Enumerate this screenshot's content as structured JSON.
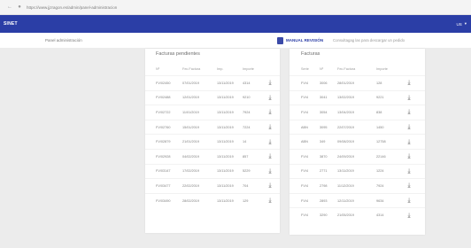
{
  "browser": {
    "url": "https://www.jjzragon.es/admin/panel-administracion"
  },
  "appbar": {
    "brand": "SINET",
    "user_label": "US"
  },
  "subbar": {
    "breadcrumb": "Panel administración",
    "manual_label": "MANUAL REVISIÓN",
    "hint": "Consultagag las para descargar un pedido"
  },
  "left_panel": {
    "title": "Facturas pendientes",
    "headers": [
      "Nº",
      "Fec.Factura",
      "Imp.",
      "Importe"
    ],
    "rows": [
      [
        "FV/02450",
        "07/01/2019",
        "13/11/2019",
        "4314"
      ],
      [
        "FV/02488",
        "12/01/2019",
        "13/11/2019",
        "9210"
      ],
      [
        "FV/02722",
        "11/01/2019",
        "13/11/2019",
        "7924"
      ],
      [
        "FV/02760",
        "15/01/2019",
        "13/11/2019",
        "7224"
      ],
      [
        "FV/02879",
        "21/01/2019",
        "13/11/2019",
        "14"
      ],
      [
        "FV/02928",
        "04/02/2019",
        "13/11/2019",
        "857"
      ],
      [
        "FV/03147",
        "17/02/2019",
        "13/11/2019",
        "5229"
      ],
      [
        "FV/03477",
        "22/02/2019",
        "13/11/2019",
        "704"
      ],
      [
        "FV/03490",
        "28/02/2019",
        "13/11/2019",
        "129"
      ]
    ]
  },
  "right_panel": {
    "title": "Facturas",
    "headers": [
      "Serie",
      "Nº",
      "Fec.Factura",
      "Importe"
    ],
    "rows": [
      [
        "FV/4",
        "3006",
        "28/01/2019",
        "128"
      ],
      [
        "FV/4",
        "3041",
        "13/02/2019",
        "9221"
      ],
      [
        "FV/4",
        "3054",
        "13/04/2019",
        "838"
      ],
      [
        "ABN",
        "3095",
        "22/07/2019",
        "1450"
      ],
      [
        "ABN",
        "349",
        "09/08/2019",
        "12758"
      ],
      [
        "FV/4",
        "3870",
        "24/09/2019",
        "22146"
      ],
      [
        "FV/4",
        "2771",
        "13/11/2019",
        "1224"
      ],
      [
        "FV/4",
        "2798",
        "11/12/2019",
        "7924"
      ],
      [
        "FV/4",
        "2893",
        "12/11/2019",
        "9634"
      ],
      [
        "FV/4",
        "3290",
        "21/05/2019",
        "4314"
      ]
    ]
  },
  "icons": {
    "download": "download-icon",
    "pdf": "pdf-icon"
  }
}
